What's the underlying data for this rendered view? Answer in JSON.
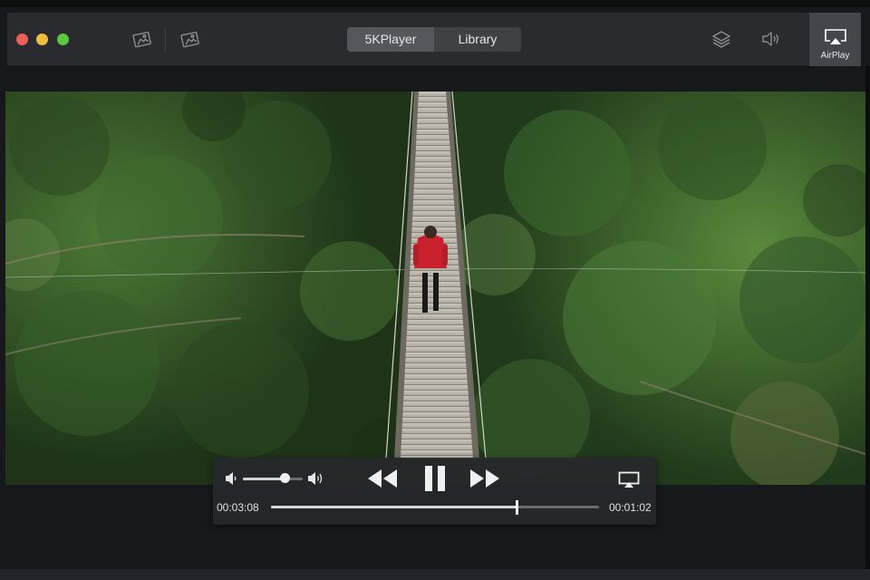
{
  "window": {
    "buttons": [
      "close",
      "minimize",
      "zoom"
    ]
  },
  "toolbar": {
    "left_icons": [
      "photo-icon",
      "photo-icon"
    ],
    "tabs": [
      {
        "label": "5KPlayer",
        "active": true
      },
      {
        "label": "Library",
        "active": false
      }
    ],
    "right_icons": [
      "layers-icon",
      "speaker-icon"
    ],
    "airplay_label": "AirPlay"
  },
  "video": {
    "scene": "suspension bridge over forest with person in red jacket"
  },
  "controls": {
    "volume_level": 0.7,
    "elapsed": "00:03:08",
    "remaining": "00:01:02",
    "progress": 0.75,
    "buttons": [
      "rewind",
      "pause",
      "fast-forward",
      "airplay-screen"
    ]
  },
  "colors": {
    "close": "#ee5f57",
    "minimize": "#f2bd3e",
    "zoom": "#5cc841",
    "titlebar": "#2a2b2f",
    "tab_active": "#55575c",
    "tab_inactive": "#404145"
  }
}
